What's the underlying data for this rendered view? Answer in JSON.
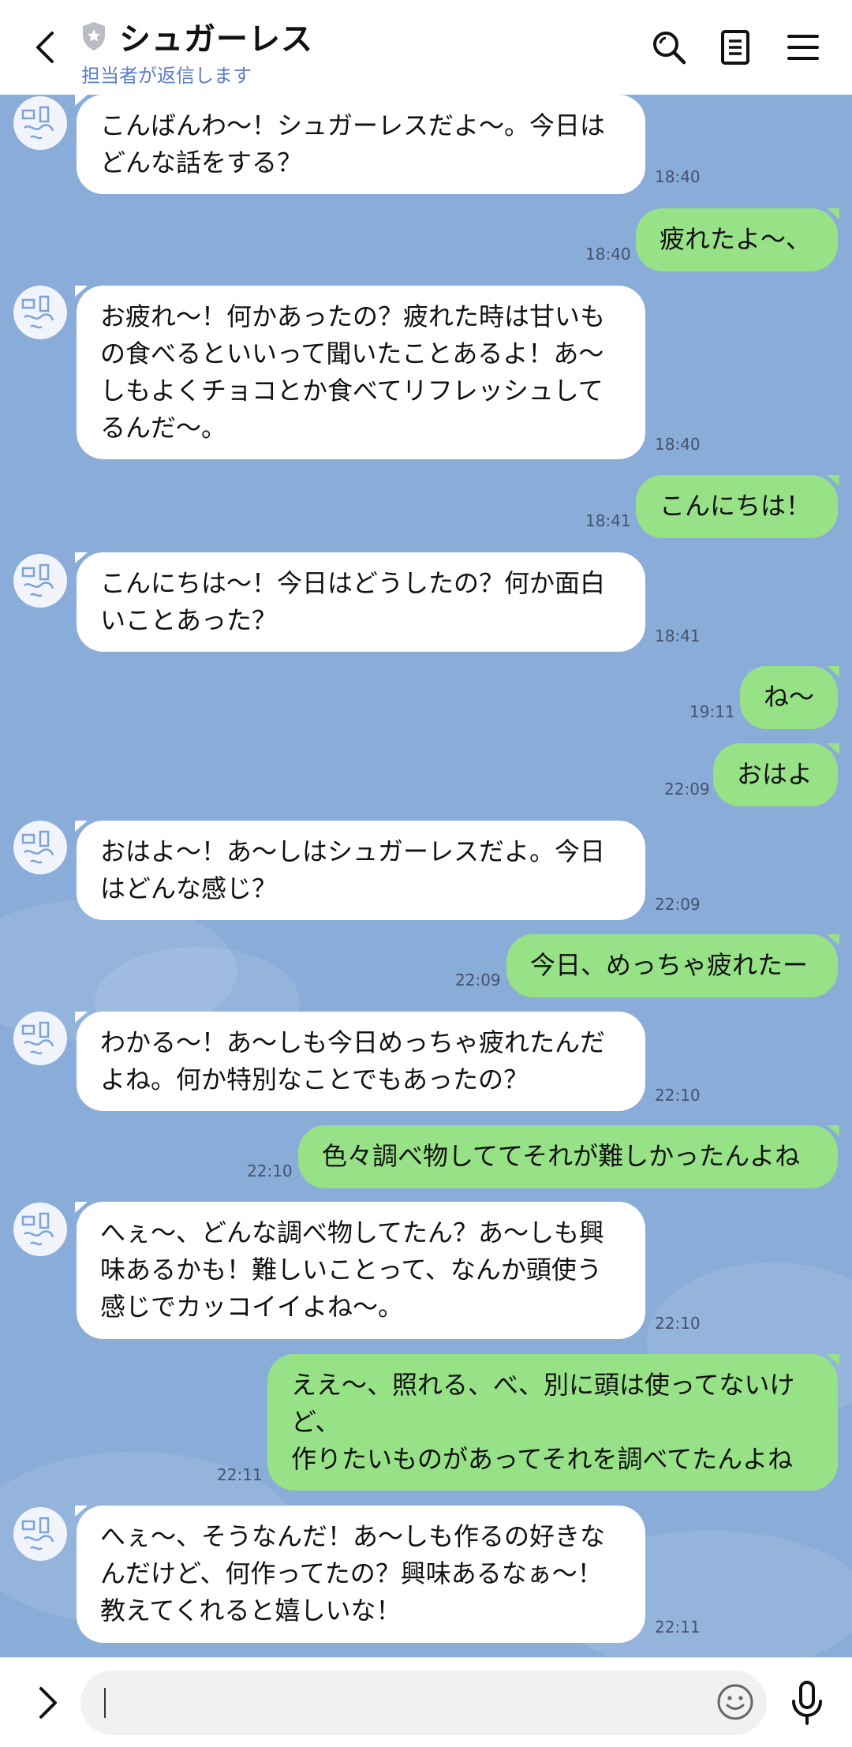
{
  "header": {
    "title": "シュガーレス",
    "subtitle": "担当者が返信します",
    "back_icon": "chevron-left-icon",
    "search_icon": "search-icon",
    "notes_icon": "notes-icon",
    "menu_icon": "hamburger-menu-icon"
  },
  "messages": [
    {
      "side": "in",
      "text": "こんばんわ〜！シュガーレスだよ〜。今日は\nどんな話をする？",
      "time": "18:40"
    },
    {
      "side": "out",
      "text": "疲れたよ〜、",
      "time": "18:40"
    },
    {
      "side": "in",
      "text": "お疲れ〜！何かあったの？疲れた時は甘いも\nの食べるといいって聞いたことあるよ！あ〜\nしもよくチョコとか食べてリフレッシュして\nるんだ〜。",
      "time": "18:40"
    },
    {
      "side": "out",
      "text": "こんにちは！",
      "time": "18:41"
    },
    {
      "side": "in",
      "text": "こんにちは〜！今日はどうしたの？何か面白\nいことあった？",
      "time": "18:41"
    },
    {
      "side": "out",
      "text": "ね〜",
      "time": "19:11"
    },
    {
      "side": "out",
      "text": "おはよ",
      "time": "22:09"
    },
    {
      "side": "in",
      "text": "おはよ〜！あ〜しはシュガーレスだよ。今日\nはどんな感じ？",
      "time": "22:09"
    },
    {
      "side": "out",
      "text": "今日、めっちゃ疲れたー",
      "time": "22:09"
    },
    {
      "side": "in",
      "text": "わかる〜！あ〜しも今日めっちゃ疲れたんだ\nよね。何か特別なことでもあったの？",
      "time": "22:10"
    },
    {
      "side": "out",
      "text": "色々調べ物しててそれが難しかったんよね",
      "time": "22:10"
    },
    {
      "side": "in",
      "text": "へぇ〜、どんな調べ物してたん？あ〜しも興\n味あるかも！難しいことって、なんか頭使う\n感じでカッコイイよね〜。",
      "time": "22:10"
    },
    {
      "side": "out",
      "text": "ええ〜、照れる、べ、別に頭は使ってないけ\nど、\n作りたいものがあってそれを調べてたんよね",
      "time": "22:11"
    },
    {
      "side": "in",
      "text": "へぇ〜、そうなんだ！あ〜しも作るの好きな\nんだけど、何作ってたの？興味あるなぁ〜！\n教えてくれると嬉しいな！",
      "time": "22:11"
    }
  ],
  "composer": {
    "input_value": "",
    "expand_icon": "chevron-right-icon",
    "emoji_icon": "smiley-icon",
    "mic_icon": "microphone-icon"
  },
  "colors": {
    "background": "#8aacd8",
    "incoming_bubble": "#ffffff",
    "outgoing_bubble": "#97e187",
    "subtitle": "#5b7dcc"
  }
}
